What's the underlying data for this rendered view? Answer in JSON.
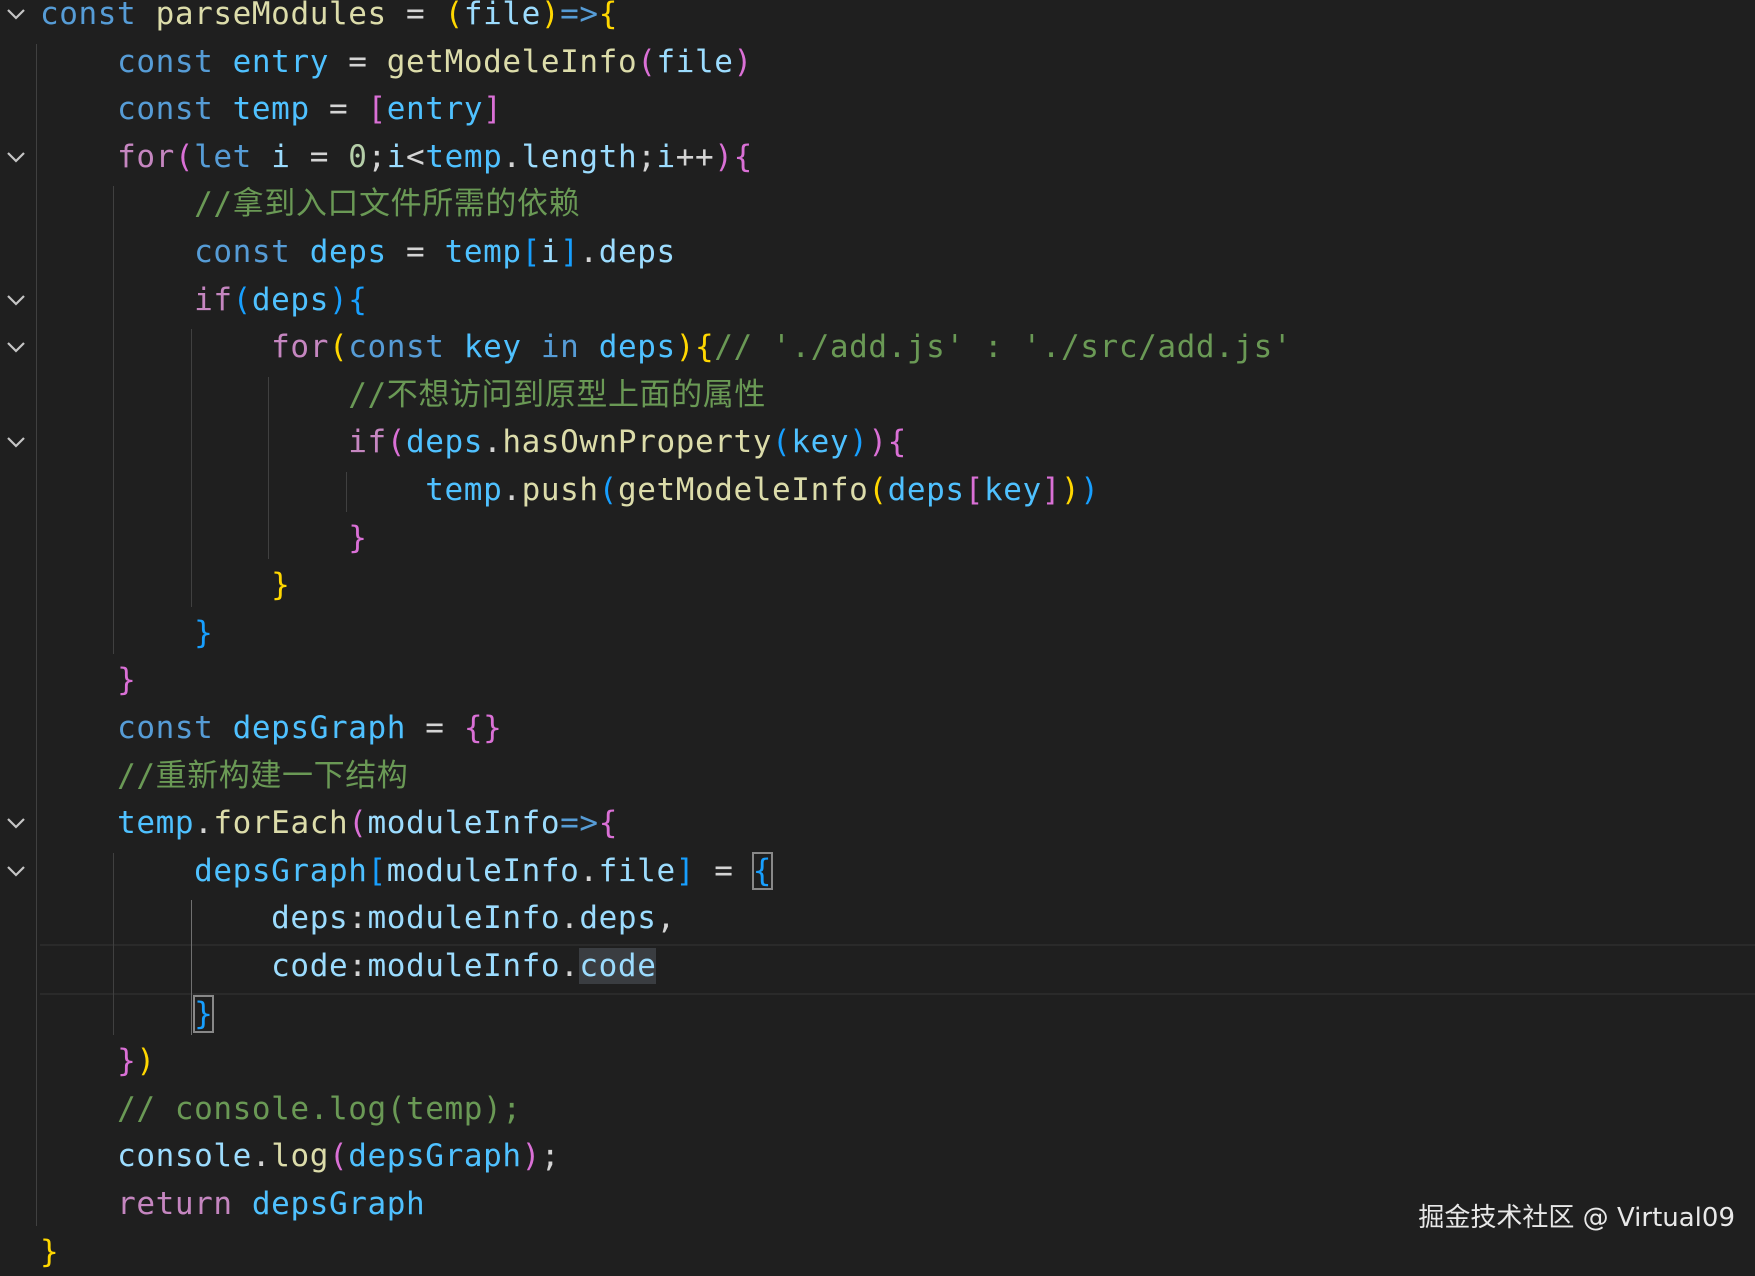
{
  "editor": {
    "lines": [
      {
        "tokens": [
          [
            "k",
            "const"
          ],
          [
            "o",
            " "
          ],
          [
            "f",
            "parseModules"
          ],
          [
            "o",
            " = "
          ],
          [
            "b1",
            "("
          ],
          [
            "p",
            "file"
          ],
          [
            "b1",
            ")"
          ],
          [
            "k",
            "=>"
          ],
          [
            "b1",
            "{"
          ]
        ]
      },
      {
        "tokens": [
          [
            "o",
            "    "
          ],
          [
            "k",
            "const"
          ],
          [
            "o",
            " "
          ],
          [
            "v",
            "entry"
          ],
          [
            "o",
            " = "
          ],
          [
            "f",
            "getModeleInfo"
          ],
          [
            "b2",
            "("
          ],
          [
            "p",
            "file"
          ],
          [
            "b2",
            ")"
          ]
        ]
      },
      {
        "tokens": [
          [
            "o",
            "    "
          ],
          [
            "k",
            "const"
          ],
          [
            "o",
            " "
          ],
          [
            "v",
            "temp"
          ],
          [
            "o",
            " = "
          ],
          [
            "b2",
            "["
          ],
          [
            "v",
            "entry"
          ],
          [
            "b2",
            "]"
          ]
        ]
      },
      {
        "tokens": [
          [
            "o",
            "    "
          ],
          [
            "c",
            "for"
          ],
          [
            "b2",
            "("
          ],
          [
            "k",
            "let"
          ],
          [
            "o",
            " "
          ],
          [
            "p",
            "i"
          ],
          [
            "o",
            " = "
          ],
          [
            "n",
            "0"
          ],
          [
            "o",
            ";"
          ],
          [
            "p",
            "i"
          ],
          [
            "o",
            "<"
          ],
          [
            "v",
            "temp"
          ],
          [
            "o",
            "."
          ],
          [
            "p",
            "length"
          ],
          [
            "o",
            ";"
          ],
          [
            "p",
            "i"
          ],
          [
            "o",
            "++"
          ],
          [
            "b2",
            ")"
          ],
          [
            "b2",
            "{"
          ]
        ]
      },
      {
        "tokens": [
          [
            "o",
            "        "
          ],
          [
            "cm",
            "//拿到入口文件所需的依赖"
          ]
        ]
      },
      {
        "tokens": [
          [
            "o",
            "        "
          ],
          [
            "k",
            "const"
          ],
          [
            "o",
            " "
          ],
          [
            "v",
            "deps"
          ],
          [
            "o",
            " = "
          ],
          [
            "v",
            "temp"
          ],
          [
            "b3",
            "["
          ],
          [
            "p",
            "i"
          ],
          [
            "b3",
            "]"
          ],
          [
            "o",
            "."
          ],
          [
            "p",
            "deps"
          ]
        ]
      },
      {
        "tokens": [
          [
            "o",
            "        "
          ],
          [
            "c",
            "if"
          ],
          [
            "b3",
            "("
          ],
          [
            "v",
            "deps"
          ],
          [
            "b3",
            ")"
          ],
          [
            "b3",
            "{"
          ]
        ]
      },
      {
        "tokens": [
          [
            "o",
            "            "
          ],
          [
            "c",
            "for"
          ],
          [
            "b1",
            "("
          ],
          [
            "k",
            "const"
          ],
          [
            "o",
            " "
          ],
          [
            "v",
            "key"
          ],
          [
            "o",
            " "
          ],
          [
            "k",
            "in"
          ],
          [
            "o",
            " "
          ],
          [
            "v",
            "deps"
          ],
          [
            "b1",
            ")"
          ],
          [
            "b1",
            "{"
          ],
          [
            "cm",
            "// './add.js' : './src/add.js'"
          ]
        ]
      },
      {
        "tokens": [
          [
            "o",
            "                "
          ],
          [
            "cm",
            "//不想访问到原型上面的属性"
          ]
        ]
      },
      {
        "tokens": [
          [
            "o",
            "                "
          ],
          [
            "c",
            "if"
          ],
          [
            "b2",
            "("
          ],
          [
            "v",
            "deps"
          ],
          [
            "o",
            "."
          ],
          [
            "f",
            "hasOwnProperty"
          ],
          [
            "b3",
            "("
          ],
          [
            "v",
            "key"
          ],
          [
            "b3",
            ")"
          ],
          [
            "b2",
            ")"
          ],
          [
            "b2",
            "{"
          ]
        ]
      },
      {
        "tokens": [
          [
            "o",
            "                    "
          ],
          [
            "v",
            "temp"
          ],
          [
            "o",
            "."
          ],
          [
            "f",
            "push"
          ],
          [
            "b3",
            "("
          ],
          [
            "f",
            "getModeleInfo"
          ],
          [
            "b1",
            "("
          ],
          [
            "v",
            "deps"
          ],
          [
            "b2",
            "["
          ],
          [
            "v",
            "key"
          ],
          [
            "b2",
            "]"
          ],
          [
            "b1",
            ")"
          ],
          [
            "b3",
            ")"
          ]
        ]
      },
      {
        "tokens": [
          [
            "o",
            "                "
          ],
          [
            "b2",
            "}"
          ]
        ]
      },
      {
        "tokens": [
          [
            "o",
            "            "
          ],
          [
            "b1",
            "}"
          ]
        ]
      },
      {
        "tokens": [
          [
            "o",
            "        "
          ],
          [
            "b3",
            "}"
          ]
        ]
      },
      {
        "tokens": [
          [
            "o",
            "    "
          ],
          [
            "b2",
            "}"
          ]
        ]
      },
      {
        "tokens": [
          [
            "o",
            "    "
          ],
          [
            "k",
            "const"
          ],
          [
            "o",
            " "
          ],
          [
            "v",
            "depsGraph"
          ],
          [
            "o",
            " = "
          ],
          [
            "b2",
            "{}"
          ]
        ]
      },
      {
        "tokens": [
          [
            "o",
            "    "
          ],
          [
            "cm",
            "//重新构建一下结构"
          ]
        ]
      },
      {
        "tokens": [
          [
            "o",
            "    "
          ],
          [
            "v",
            "temp"
          ],
          [
            "o",
            "."
          ],
          [
            "f",
            "forEach"
          ],
          [
            "b2",
            "("
          ],
          [
            "p",
            "moduleInfo"
          ],
          [
            "k",
            "=>"
          ],
          [
            "b2",
            "{"
          ]
        ]
      },
      {
        "tokens": [
          [
            "o",
            "        "
          ],
          [
            "v",
            "depsGraph"
          ],
          [
            "b3",
            "["
          ],
          [
            "p",
            "moduleInfo"
          ],
          [
            "o",
            "."
          ],
          [
            "p",
            "file"
          ],
          [
            "b3",
            "]"
          ],
          [
            "o",
            " = "
          ],
          [
            "b3 box",
            "{"
          ]
        ]
      },
      {
        "tokens": [
          [
            "o",
            "            "
          ],
          [
            "p",
            "deps"
          ],
          [
            "o",
            ":"
          ],
          [
            "p",
            "moduleInfo"
          ],
          [
            "o",
            "."
          ],
          [
            "p",
            "deps"
          ],
          [
            "o",
            ","
          ]
        ]
      },
      {
        "tokens": [
          [
            "o",
            "            "
          ],
          [
            "p",
            "code"
          ],
          [
            "o",
            ":"
          ],
          [
            "p",
            "moduleInfo"
          ],
          [
            "o",
            "."
          ],
          [
            "p sel",
            "code"
          ]
        ]
      },
      {
        "tokens": [
          [
            "o",
            "        "
          ],
          [
            "b3 box",
            "}"
          ]
        ]
      },
      {
        "tokens": [
          [
            "o",
            "    "
          ],
          [
            "b2",
            "}"
          ],
          [
            "b1",
            ")"
          ]
        ]
      },
      {
        "tokens": [
          [
            "o",
            "    "
          ],
          [
            "cm",
            "// console.log(temp);"
          ]
        ]
      },
      {
        "tokens": [
          [
            "o",
            "    "
          ],
          [
            "p",
            "console"
          ],
          [
            "o",
            "."
          ],
          [
            "f",
            "log"
          ],
          [
            "b2",
            "("
          ],
          [
            "v",
            "depsGraph"
          ],
          [
            "b2",
            ")"
          ],
          [
            "o",
            ";"
          ]
        ]
      },
      {
        "tokens": [
          [
            "o",
            "    "
          ],
          [
            "c",
            "return"
          ],
          [
            "o",
            " "
          ],
          [
            "v",
            "depsGraph"
          ]
        ]
      },
      {
        "tokens": [
          [
            "b1",
            "}"
          ]
        ]
      }
    ],
    "fold_lines": [
      0,
      3,
      6,
      7,
      9,
      17,
      18
    ]
  },
  "colors": {
    "background": "#1f1f1f",
    "keyword": "#569cd6",
    "control": "#c586c0",
    "variable": "#4fc1ff",
    "function": "#dcdcaa",
    "property": "#9cdcfe",
    "comment": "#6a9955",
    "bracket_gold": "#ffd700",
    "bracket_orchid": "#da70d6",
    "bracket_blue": "#179fff"
  },
  "icons": {
    "fold": "chevron-down-icon"
  },
  "watermark": {
    "text": "掘金技术社区 @ Virtual09"
  }
}
